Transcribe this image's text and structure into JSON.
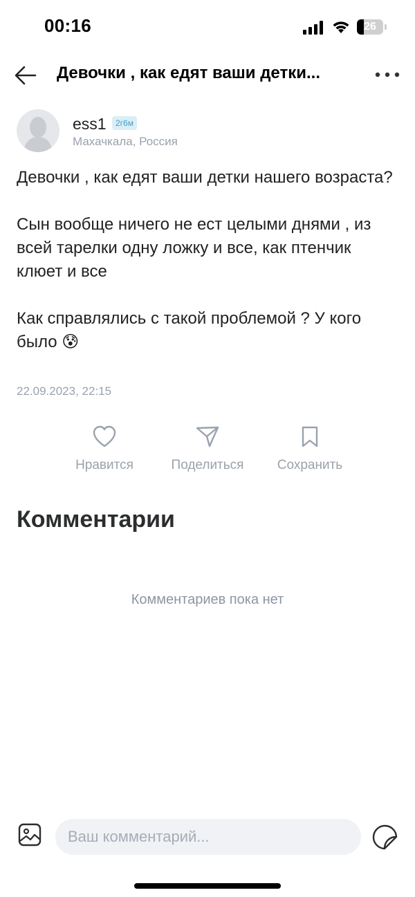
{
  "status_bar": {
    "time": "00:16",
    "battery": "26",
    "battery_level": 0.26
  },
  "header": {
    "title": "Девочки , как едят ваши детки..."
  },
  "author": {
    "username": "ess1",
    "badge": "2г6м",
    "location": "Махачкала, Россия"
  },
  "post": {
    "paragraphs": [
      "Девочки , как едят ваши детки нашего возраста?",
      "Сын вообще ничего не ест целыми днями , из всей тарелки одну ложку и все, как птенчик клюет и все",
      "Как справлялись с такой проблемой ? У кого было 😰"
    ],
    "date": "22.09.2023, 22:15"
  },
  "actions": {
    "like": "Нравится",
    "share": "Поделиться",
    "save": "Сохранить"
  },
  "comments": {
    "title": "Комментарии",
    "empty_text": "Комментариев пока нет"
  },
  "composer": {
    "placeholder": "Ваш комментарий..."
  },
  "icons": {
    "back": "arrow-left-icon",
    "more": "more-horizontal-icon",
    "like": "heart-icon",
    "share": "send-icon",
    "save": "bookmark-icon",
    "image": "image-icon",
    "sticker": "sticker-icon"
  },
  "colors": {
    "muted": "#99a2ad",
    "badge_bg": "#dbeef7",
    "badge_text": "#3fa0c8",
    "input_bg": "#f0f2f5"
  }
}
